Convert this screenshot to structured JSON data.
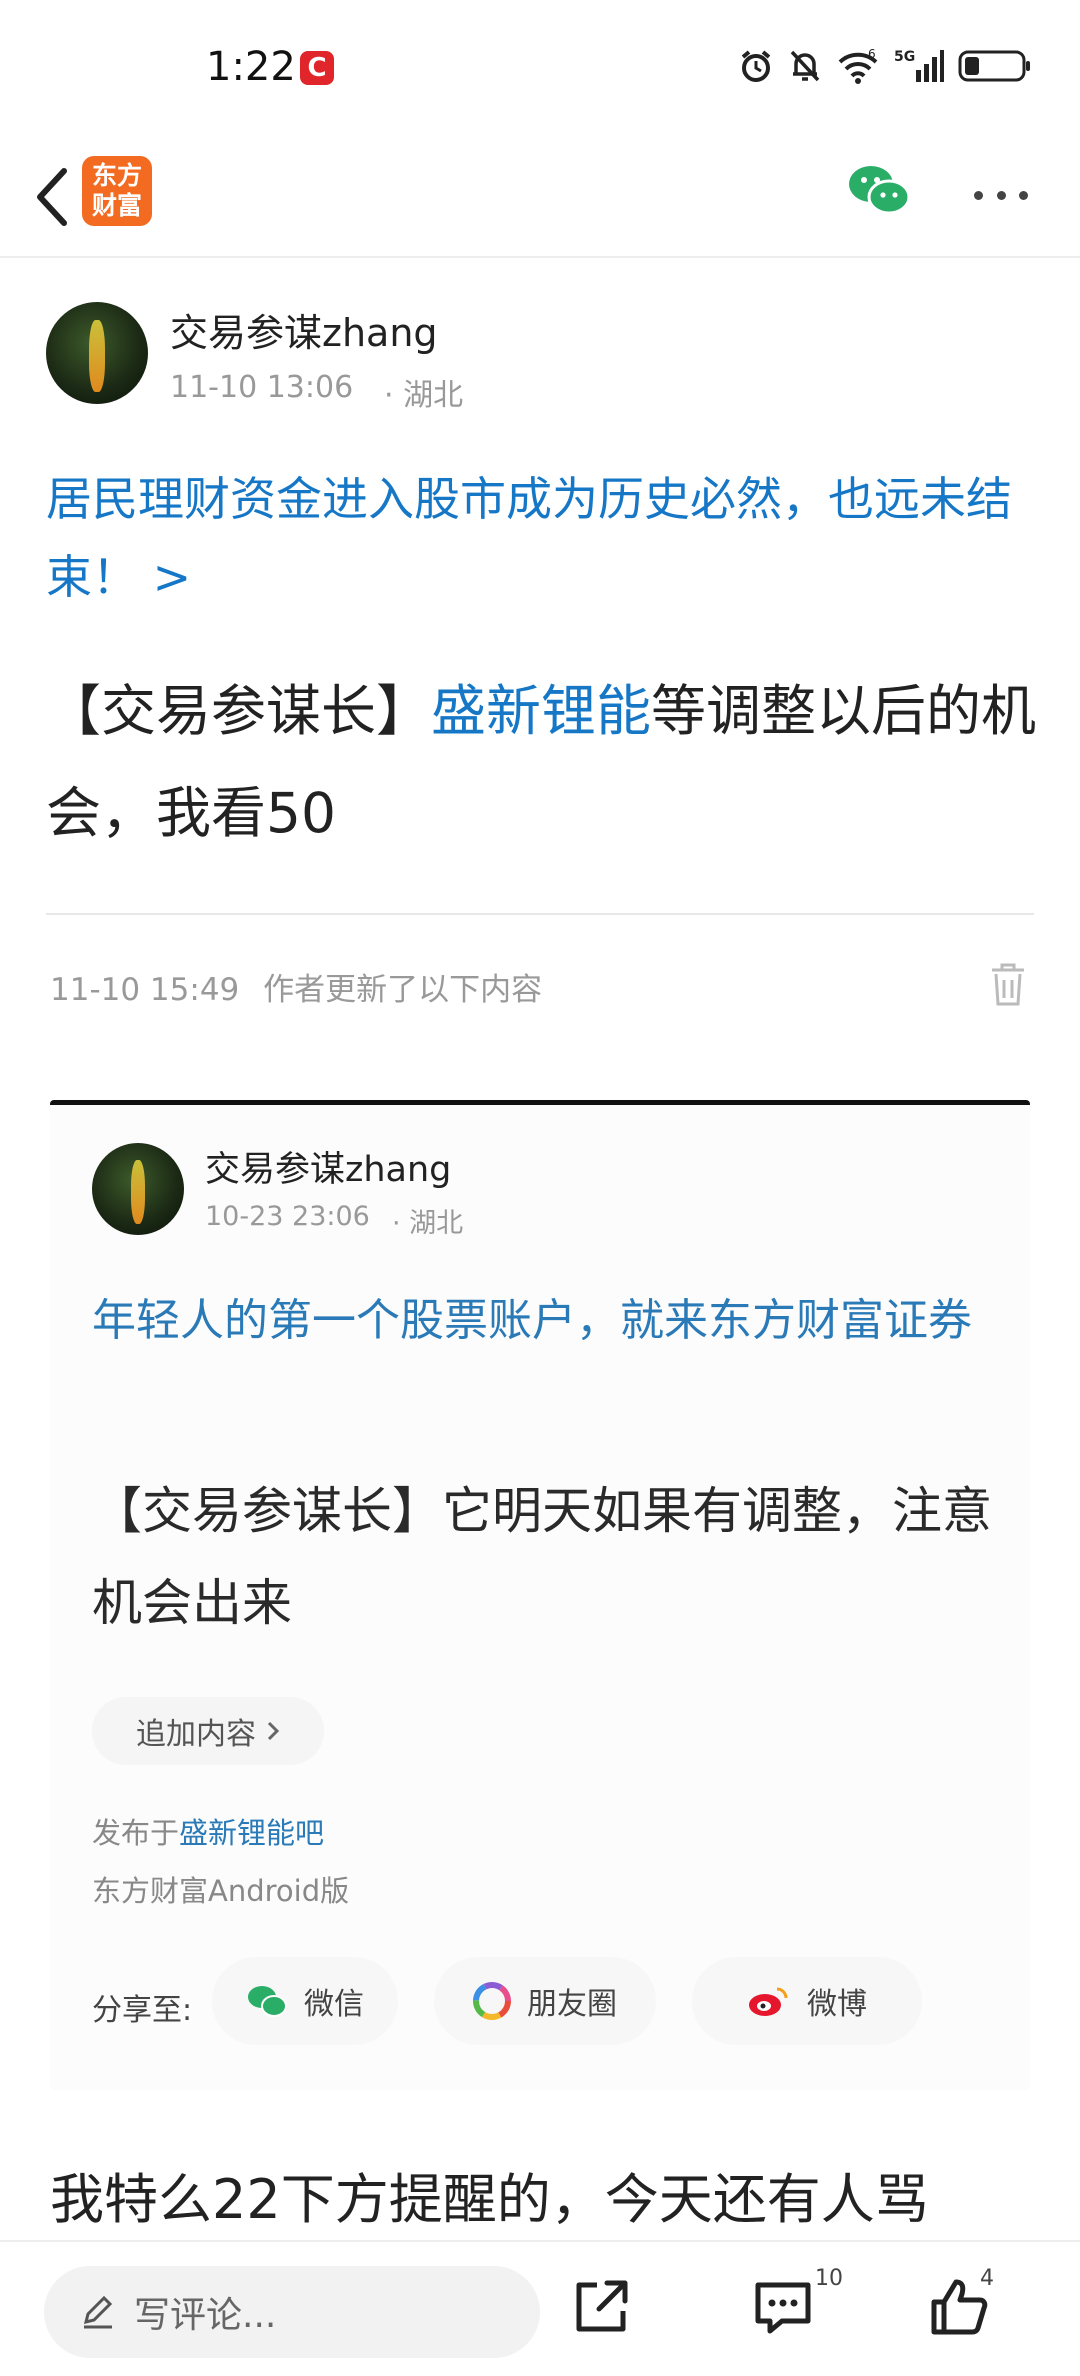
{
  "status_bar": {
    "time": "1:22",
    "app_badge": "C",
    "icons": [
      "alarm-icon",
      "mute-icon",
      "wifi-icon",
      "signal-5g-icon",
      "battery-icon"
    ],
    "wifi_label": "6",
    "network_label": "5G"
  },
  "nav": {
    "logo_line1": "东方",
    "logo_line2": "财富",
    "accent_color": "#f26b21",
    "share_color": "#2aae67"
  },
  "post": {
    "author": "交易参谋zhang",
    "timestamp": "11-10 13:06",
    "location": "· 湖北",
    "topic_link": "居民理财资金进入股市成为历史必然，也远未结束！ >",
    "body_prefix": "【交易参谋长】",
    "stock_name": "盛新锂能",
    "body_suffix": "等调整以后的机会，我看50",
    "update_time": "11-10 15:49",
    "update_text": "作者更新了以下内容",
    "continuation": "我特么22下方提醒的，今天还有人骂"
  },
  "embedded": {
    "author": "交易参谋zhang",
    "timestamp": "10-23 23:06",
    "location": "· 湖北",
    "topic_link": "年轻人的第一个股票账户，就来东方财富证券",
    "body": "【交易参谋长】它明天如果有调整，注意机会出来",
    "add_content": "追加内容",
    "published_prefix": "发布于",
    "board": "盛新锂能吧",
    "client": "东方财富Android版",
    "share_label": "分享至:",
    "share_wechat": "微信",
    "share_moments": "朋友圈",
    "share_weibo": "微博"
  },
  "bottom_bar": {
    "comment_placeholder": "写评论...",
    "comment_count": "10",
    "like_count": "4"
  }
}
